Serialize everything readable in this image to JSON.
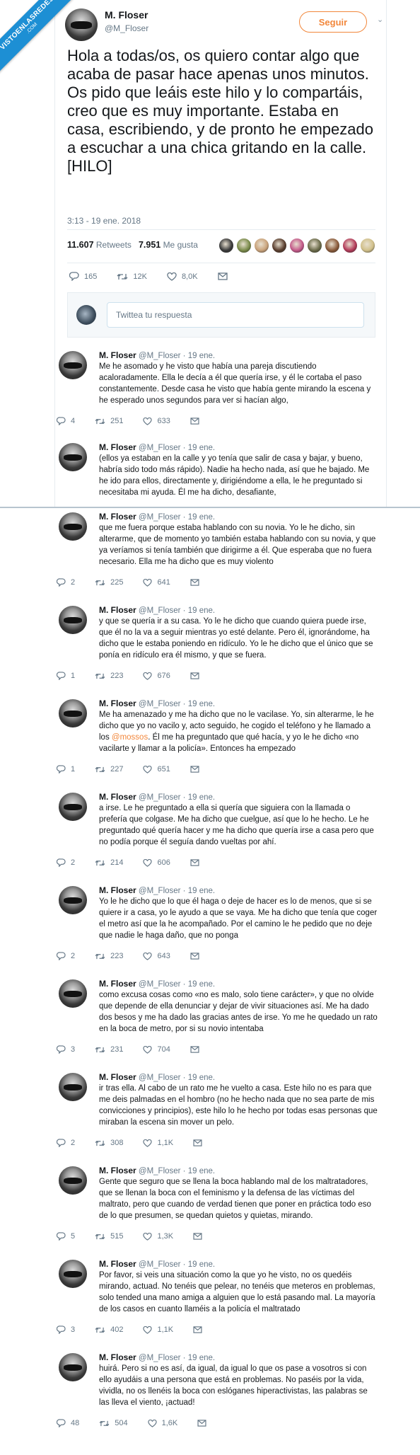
{
  "watermark": {
    "line1": "VISTOENLASREDES",
    "line2": ".COM"
  },
  "main_tweet": {
    "name": "M. Floser",
    "handle": "@M_Floser",
    "follow_label": "Seguir",
    "text": "Hola a todas/os, os quiero contar algo que acaba de pasar hace apenas unos minutos. Os pido que leáis este hilo y lo compartáis, creo que es muy importante. Estaba en casa, escribiendo, y de pronto he empezado a escuchar a una chica gritando en la calle. [HILO]",
    "timestamp": "3:13 - 19 ene. 2018",
    "retweets_count": "11.607",
    "retweets_label": "Retweets",
    "likes_count": "7.951",
    "likes_label": "Me gusta",
    "replies": "165",
    "rts": "12K",
    "likes": "8,0K",
    "liker_colors": [
      "#3a3a3a",
      "#7a8b4a",
      "#c9a27a",
      "#5a3e2e",
      "#c45a8a",
      "#6b6b4a",
      "#8a5a3a",
      "#b33b5a",
      "#d1c08a"
    ]
  },
  "reply_box": {
    "placeholder": "Twittea tu respuesta"
  },
  "thread": [
    {
      "name": "M. Floser",
      "handle": "@M_Floser · 19 ene.",
      "text": "Me he asomado y he visto que había una pareja discutiendo acaloradamente. Ella le decía a él que quería irse, y él le cortaba el paso constantemente. Desde casa he visto que había gente mirando la escena y he esperado unos segundos para ver si hacían algo,",
      "replies": "4",
      "rts": "251",
      "likes": "633"
    },
    {
      "name": "M. Floser",
      "handle": "@M_Floser · 19 ene.",
      "text": "(ellos ya estaban en la calle y yo tenía que salir de casa y bajar, y bueno, habría sido todo más rápido). Nadie ha hecho nada, así que he bajado. Me he ido para ellos, directamente y, dirigiéndome a ella, le he preguntado si necesitaba mi ayuda. Él me ha dicho, desafiante,"
    },
    {
      "name": "M. Floser",
      "handle": "@M_Floser · 19 ene.",
      "text": "que me fuera porque estaba hablando con su novia. Yo le he dicho, sin alterarme, que de momento yo también estaba hablando con su novia, y que ya veríamos si tenía también que dirigirme a él. Que esperaba que no fuera necesario. Ella me ha dicho que es muy violento",
      "replies": "2",
      "rts": "225",
      "likes": "641"
    },
    {
      "name": "M. Floser",
      "handle": "@M_Floser · 19 ene.",
      "text": "y que se quería ir a su casa. Yo le he dicho que cuando quiera puede irse, que él no la va a seguir mientras yo esté delante. Pero él, ignorándome, ha dicho que le estaba poniendo en ridículo. Yo le he dicho que el único que se ponía en ridículo era él mismo, y que se fuera.",
      "replies": "1",
      "rts": "223",
      "likes": "676"
    },
    {
      "name": "M. Floser",
      "handle": "@M_Floser · 19 ene.",
      "text_before": "Me ha amenazado y me ha dicho que no le vacilase. Yo, sin alterarme, le he dicho que yo no vacilo y, acto seguido, he cogido el teléfono y he llamado a los ",
      "mention": "@mossos",
      "text_after": ". Él me ha preguntado que qué hacía, y yo le he dicho «no vacilarte y llamar a la policía». Entonces ha empezado",
      "replies": "1",
      "rts": "227",
      "likes": "651"
    },
    {
      "name": "M. Floser",
      "handle": "@M_Floser · 19 ene.",
      "text": "a irse. Le he preguntado a ella si quería que siguiera con la llamada o prefería que colgase. Me ha dicho que cuelgue, así que lo he hecho. Le he preguntado qué quería hacer y me ha dicho que quería irse a casa pero que no podía porque él seguía dando vueltas por ahí.",
      "replies": "2",
      "rts": "214",
      "likes": "606"
    },
    {
      "name": "M. Floser",
      "handle": "@M_Floser · 19 ene.",
      "text": "Yo le he dicho que lo que él haga o deje de hacer es lo de menos, que si se quiere ir a casa, yo le ayudo a que se vaya. Me ha dicho que tenía que coger el metro así que la he acompañado. Por el camino le he pedido que no deje que nadie le haga daño, que no ponga",
      "replies": "2",
      "rts": "223",
      "likes": "643"
    },
    {
      "name": "M. Floser",
      "handle": "@M_Floser · 19 ene.",
      "text": "como excusa cosas como «no es malo, solo tiene carácter», y que no olvide que depende de ella denunciar y dejar de vivir situaciones así. Me ha dado dos besos y me ha dado las gracias antes de irse. Yo me he quedado un rato en la boca de metro, por si su novio intentaba",
      "replies": "3",
      "rts": "231",
      "likes": "704"
    },
    {
      "name": "M. Floser",
      "handle": "@M_Floser · 19 ene.",
      "text": "ir tras ella. Al cabo de un rato me he vuelto a casa. Este hilo no es para que me deis palmadas en el hombro (no he hecho nada que no sea parte de mis convicciones y principios), este hilo lo he hecho por todas esas personas que miraban la escena sin mover un pelo.",
      "replies": "2",
      "rts": "308",
      "likes": "1,1K"
    },
    {
      "name": "M. Floser",
      "handle": "@M_Floser · 19 ene.",
      "text": "Gente que seguro que se llena la boca hablando mal de los maltratadores, que se llenan la boca con el feminismo y la defensa de las víctimas del maltrato, pero que cuando de verdad tienen que poner en práctica todo eso de lo que presumen, se quedan quietos y quietas, mirando.",
      "replies": "5",
      "rts": "515",
      "likes": "1,3K"
    },
    {
      "name": "M. Floser",
      "handle": "@M_Floser · 19 ene.",
      "text": "Por favor, si veis una situación como la que yo he visto, no os quedéis mirando, actuad. No tenéis que pelear, no tenéis que meteros en problemas, solo tended una mano amiga a alguien que lo está pasando mal. La mayoría de los casos en cuanto llaméis a la policía el maltratado",
      "replies": "3",
      "rts": "402",
      "likes": "1,1K"
    },
    {
      "name": "M. Floser",
      "handle": "@M_Floser · 19 ene.",
      "text": "huirá. Pero si no es así, da igual, da igual lo que os pase a vosotros si con ello ayudáis a una persona que está en problemas. No paséis por la vida, vividla, no os llenéis la boca con eslóganes hiperactivistas, las palabras se las lleva el viento, ¡actuad!",
      "replies": "48",
      "rts": "504",
      "likes": "1,6K"
    }
  ],
  "colors": {
    "accent": "#f2873b",
    "watermark": "#1d8fd4",
    "muted": "#657786"
  }
}
